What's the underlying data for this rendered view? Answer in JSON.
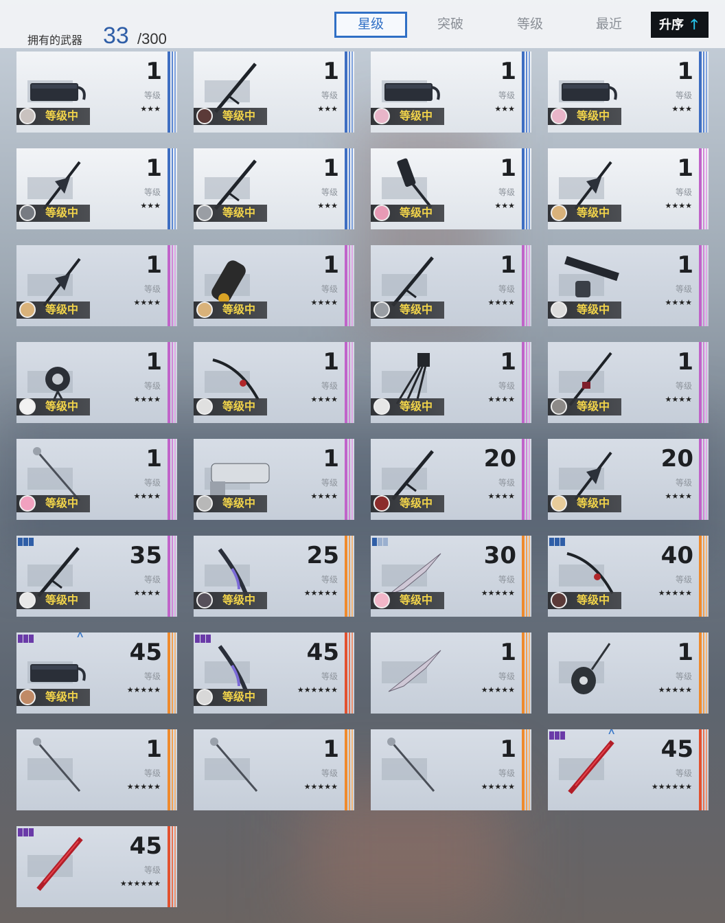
{
  "header": {
    "owned_label": "拥有的武器",
    "owned_count": "33",
    "owned_max": "/300",
    "sort_tabs": [
      "星级",
      "突破",
      "等级",
      "最近"
    ],
    "active_tab": "星级",
    "order_label": "升序",
    "order_icon": "arrow-up-icon"
  },
  "equipped_label": "等级中",
  "level_label": "等级",
  "colors": {
    "accent": "#2f6fc5",
    "equipped_text": "#f2d44a",
    "rarity3": "#3e6ec2",
    "rarity4": "#c063c9",
    "rarity5": "#ef8a2c",
    "rarity6": "#e2512f"
  },
  "weapons": [
    {
      "level": "1",
      "stars": "★★★",
      "rarity": "blue",
      "equipped": true,
      "avatar": "#c9c2bf",
      "icon": "gun-icon"
    },
    {
      "level": "1",
      "stars": "★★★",
      "rarity": "blue",
      "equipped": true,
      "avatar": "#5b3a38",
      "icon": "sword-icon"
    },
    {
      "level": "1",
      "stars": "★★★",
      "rarity": "blue",
      "equipped": true,
      "avatar": "#e8b5c8",
      "icon": "gun-icon"
    },
    {
      "level": "1",
      "stars": "★★★",
      "rarity": "blue",
      "equipped": true,
      "avatar": "#e8b5c8",
      "icon": "gun-icon"
    },
    {
      "level": "1",
      "stars": "★★★",
      "rarity": "blue",
      "equipped": true,
      "avatar": "#777b82",
      "icon": "axe-icon"
    },
    {
      "level": "1",
      "stars": "★★★",
      "rarity": "blue",
      "equipped": true,
      "avatar": "#9a9ea4",
      "icon": "sword-icon"
    },
    {
      "level": "1",
      "stars": "★★★",
      "rarity": "blue",
      "equipped": true,
      "avatar": "#e89ab5",
      "icon": "scythe-icon"
    },
    {
      "level": "1",
      "stars": "★★★★",
      "rarity": "purple",
      "equipped": true,
      "avatar": "#d9b27a",
      "icon": "axe-icon"
    },
    {
      "level": "1",
      "stars": "★★★★",
      "rarity": "purple",
      "equipped": true,
      "avatar": "#d9b27a",
      "icon": "axe-icon"
    },
    {
      "level": "1",
      "stars": "★★★★",
      "rarity": "purple",
      "equipped": true,
      "avatar": "#d9b27a",
      "icon": "gauntlet-icon"
    },
    {
      "level": "1",
      "stars": "★★★★",
      "rarity": "purple",
      "equipped": true,
      "avatar": "#9a9ea4",
      "icon": "sword-icon"
    },
    {
      "level": "1",
      "stars": "★★★★",
      "rarity": "purple",
      "equipped": true,
      "avatar": "#dcdcdc",
      "icon": "rifle-icon"
    },
    {
      "level": "1",
      "stars": "★★★★",
      "rarity": "purple",
      "equipped": true,
      "avatar": "#f2f2f2",
      "icon": "drone-icon"
    },
    {
      "level": "1",
      "stars": "★★★★",
      "rarity": "purple",
      "equipped": true,
      "avatar": "#e0e0e0",
      "icon": "katana-icon"
    },
    {
      "level": "1",
      "stars": "★★★★",
      "rarity": "purple",
      "equipped": true,
      "avatar": "#e6e6e6",
      "icon": "claw-icon"
    },
    {
      "level": "1",
      "stars": "★★★★",
      "rarity": "purple",
      "equipped": true,
      "avatar": "#8d8a88",
      "icon": "spear-icon"
    },
    {
      "level": "1",
      "stars": "★★★★",
      "rarity": "purple",
      "equipped": true,
      "avatar": "#f1a1bf",
      "icon": "staff-icon"
    },
    {
      "level": "1",
      "stars": "★★★★",
      "rarity": "purple",
      "equipped": true,
      "avatar": "#b8b8b8",
      "icon": "cannon-icon"
    },
    {
      "level": "20",
      "stars": "★★★★",
      "rarity": "purple",
      "equipped": true,
      "avatar": "#8b2c2c",
      "icon": "sword-icon"
    },
    {
      "level": "20",
      "stars": "★★★★",
      "rarity": "purple",
      "equipped": true,
      "avatar": "#e8cc9a",
      "icon": "axe-icon"
    },
    {
      "level": "35",
      "stars": "★★★★",
      "rarity": "purple",
      "equipped": true,
      "avatar": "#e8e8e8",
      "icon": "sword-icon",
      "rank": "blue",
      "rank_count": 3
    },
    {
      "level": "25",
      "stars": "★★★★★",
      "rarity": "orange",
      "equipped": true,
      "avatar": "#56505a",
      "icon": "blade-icon"
    },
    {
      "level": "30",
      "stars": "★★★★★",
      "rarity": "orange",
      "equipped": true,
      "avatar": "#f2b6c8",
      "icon": "lance-icon",
      "rank": "blue",
      "rank_count": 1
    },
    {
      "level": "40",
      "stars": "★★★★★",
      "rarity": "orange",
      "equipped": true,
      "avatar": "#5b3a38",
      "icon": "katana-icon",
      "rank": "blue",
      "rank_count": 3
    },
    {
      "level": "45",
      "stars": "★★★★★",
      "rarity": "orange",
      "equipped": true,
      "avatar": "#c08a66",
      "icon": "gun-icon",
      "rank": "purple",
      "rank_count": 3,
      "upgrade": true
    },
    {
      "level": "45",
      "stars": "★★★★★★",
      "rarity": "red",
      "equipped": true,
      "avatar": "#d8d8d8",
      "icon": "blade-icon",
      "rank": "purple",
      "rank_count": 3
    },
    {
      "level": "1",
      "stars": "★★★★★",
      "rarity": "orange",
      "equipped": false,
      "icon": "lance-icon"
    },
    {
      "level": "1",
      "stars": "★★★★★",
      "rarity": "orange",
      "equipped": false,
      "icon": "lute-icon"
    },
    {
      "level": "1",
      "stars": "★★★★★",
      "rarity": "orange",
      "equipped": false,
      "icon": "staff-icon"
    },
    {
      "level": "1",
      "stars": "★★★★★",
      "rarity": "orange",
      "equipped": false,
      "icon": "staff-icon"
    },
    {
      "level": "1",
      "stars": "★★★★★",
      "rarity": "orange",
      "equipped": false,
      "icon": "staff-icon"
    },
    {
      "level": "45",
      "stars": "★★★★★★",
      "rarity": "red",
      "equipped": false,
      "icon": "crimson-blade-icon",
      "rank": "purple",
      "rank_count": 3,
      "upgrade": true
    },
    {
      "level": "45",
      "stars": "★★★★★★",
      "rarity": "red",
      "equipped": false,
      "icon": "crimson-blade-icon",
      "rank": "purple",
      "rank_count": 3
    }
  ]
}
